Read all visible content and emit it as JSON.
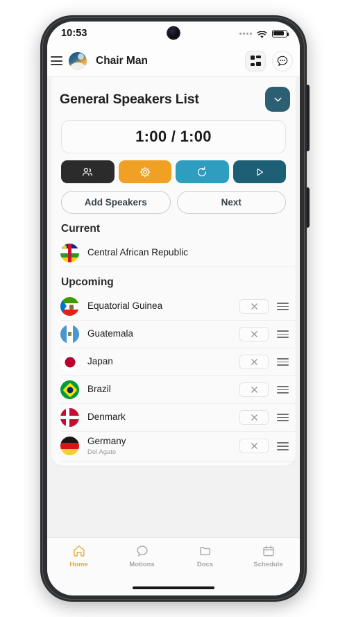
{
  "status_bar": {
    "time": "10:53",
    "signal_icon": "signal-dots-icon",
    "wifi_icon": "wifi-icon",
    "battery_icon": "battery-icon"
  },
  "app_bar": {
    "menu_icon": "hamburger-menu-icon",
    "logo_icon": "app-logo-icon",
    "title": "Chair Man",
    "grid_icon": "grid-view-icon",
    "chat_icon": "chat-bubble-icon"
  },
  "page": {
    "title": "General Speakers List",
    "collapse_icon": "chevron-down-icon",
    "collapse_color": "#2d5f73"
  },
  "timer": {
    "display": "1:00 / 1:00"
  },
  "actions": [
    {
      "name": "speakers-button",
      "icon": "people-icon",
      "color": "#2b2b2b"
    },
    {
      "name": "settings-button",
      "icon": "gear-icon",
      "color": "#f0a022"
    },
    {
      "name": "reset-button",
      "icon": "refresh-icon",
      "color": "#2e9dbf"
    },
    {
      "name": "play-button",
      "icon": "play-icon",
      "color": "#1d5f75"
    }
  ],
  "buttons": {
    "add_speakers": "Add Speakers",
    "next": "Next"
  },
  "sections": {
    "current_label": "Current",
    "upcoming_label": "Upcoming"
  },
  "current_speaker": {
    "name": "Central African Republic",
    "flag": "caf"
  },
  "upcoming": [
    {
      "name": "Equatorial Guinea",
      "sub": "",
      "flag": "gnq"
    },
    {
      "name": "Guatemala",
      "sub": "",
      "flag": "gtm"
    },
    {
      "name": "Japan",
      "sub": "",
      "flag": "jpn"
    },
    {
      "name": "Brazil",
      "sub": "",
      "flag": "bra"
    },
    {
      "name": "Denmark",
      "sub": "",
      "flag": "dnk"
    },
    {
      "name": "Germany",
      "sub": "Del Agate",
      "flag": "deu"
    }
  ],
  "row_controls": {
    "remove_icon": "close-x-icon",
    "drag_icon": "drag-handle-icon"
  },
  "tabs": [
    {
      "label": "Home",
      "icon": "home-icon",
      "active": true
    },
    {
      "label": "Motions",
      "icon": "chat-icon",
      "active": false
    },
    {
      "label": "Docs",
      "icon": "folder-icon",
      "active": false
    },
    {
      "label": "Schedule",
      "icon": "calendar-icon",
      "active": false
    }
  ],
  "colors": {
    "accent": "#e2a93b",
    "teal": "#2d5f73"
  }
}
